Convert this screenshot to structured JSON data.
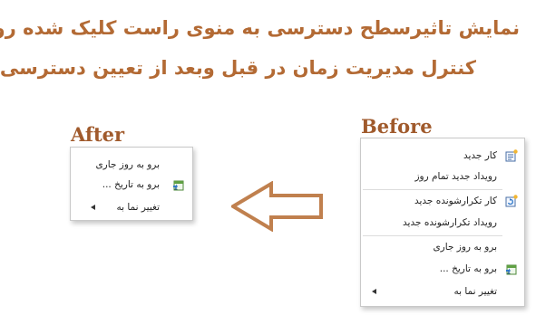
{
  "headline": {
    "line1": "نمایش تاثیرسطح دسترسی به منوی راست کلیک شده روی",
    "line2": "کنترل مدیریت زمان در قبل وبعد از تعیین دسترسی"
  },
  "labels": {
    "after": "After",
    "before": "Before"
  },
  "colors": {
    "headline": "#b36a34",
    "arrow": "#c0804e",
    "label": "#a05a2c"
  },
  "after_menu": {
    "items": [
      {
        "label": "برو به روز جاری",
        "icon": ""
      },
      {
        "label": "برو به تاریخ ...",
        "icon": "calendar-goto-icon"
      },
      {
        "label": "تغییر نما به",
        "icon": "",
        "submenu": true
      }
    ]
  },
  "before_menu": {
    "items": [
      {
        "label": "کار جدید",
        "icon": "new-task-icon"
      },
      {
        "label": "رویداد جدید تمام روز",
        "icon": ""
      },
      {
        "label": "کار تکرارشونده جدید",
        "icon": "recurring-task-icon"
      },
      {
        "label": "رویداد تکرارشونده جدید",
        "icon": ""
      },
      {
        "label": "برو به روز جاری",
        "icon": ""
      },
      {
        "label": "برو به تاریخ ...",
        "icon": "calendar-goto-icon"
      },
      {
        "label": "تغییر نما به",
        "icon": "",
        "submenu": true
      }
    ]
  }
}
